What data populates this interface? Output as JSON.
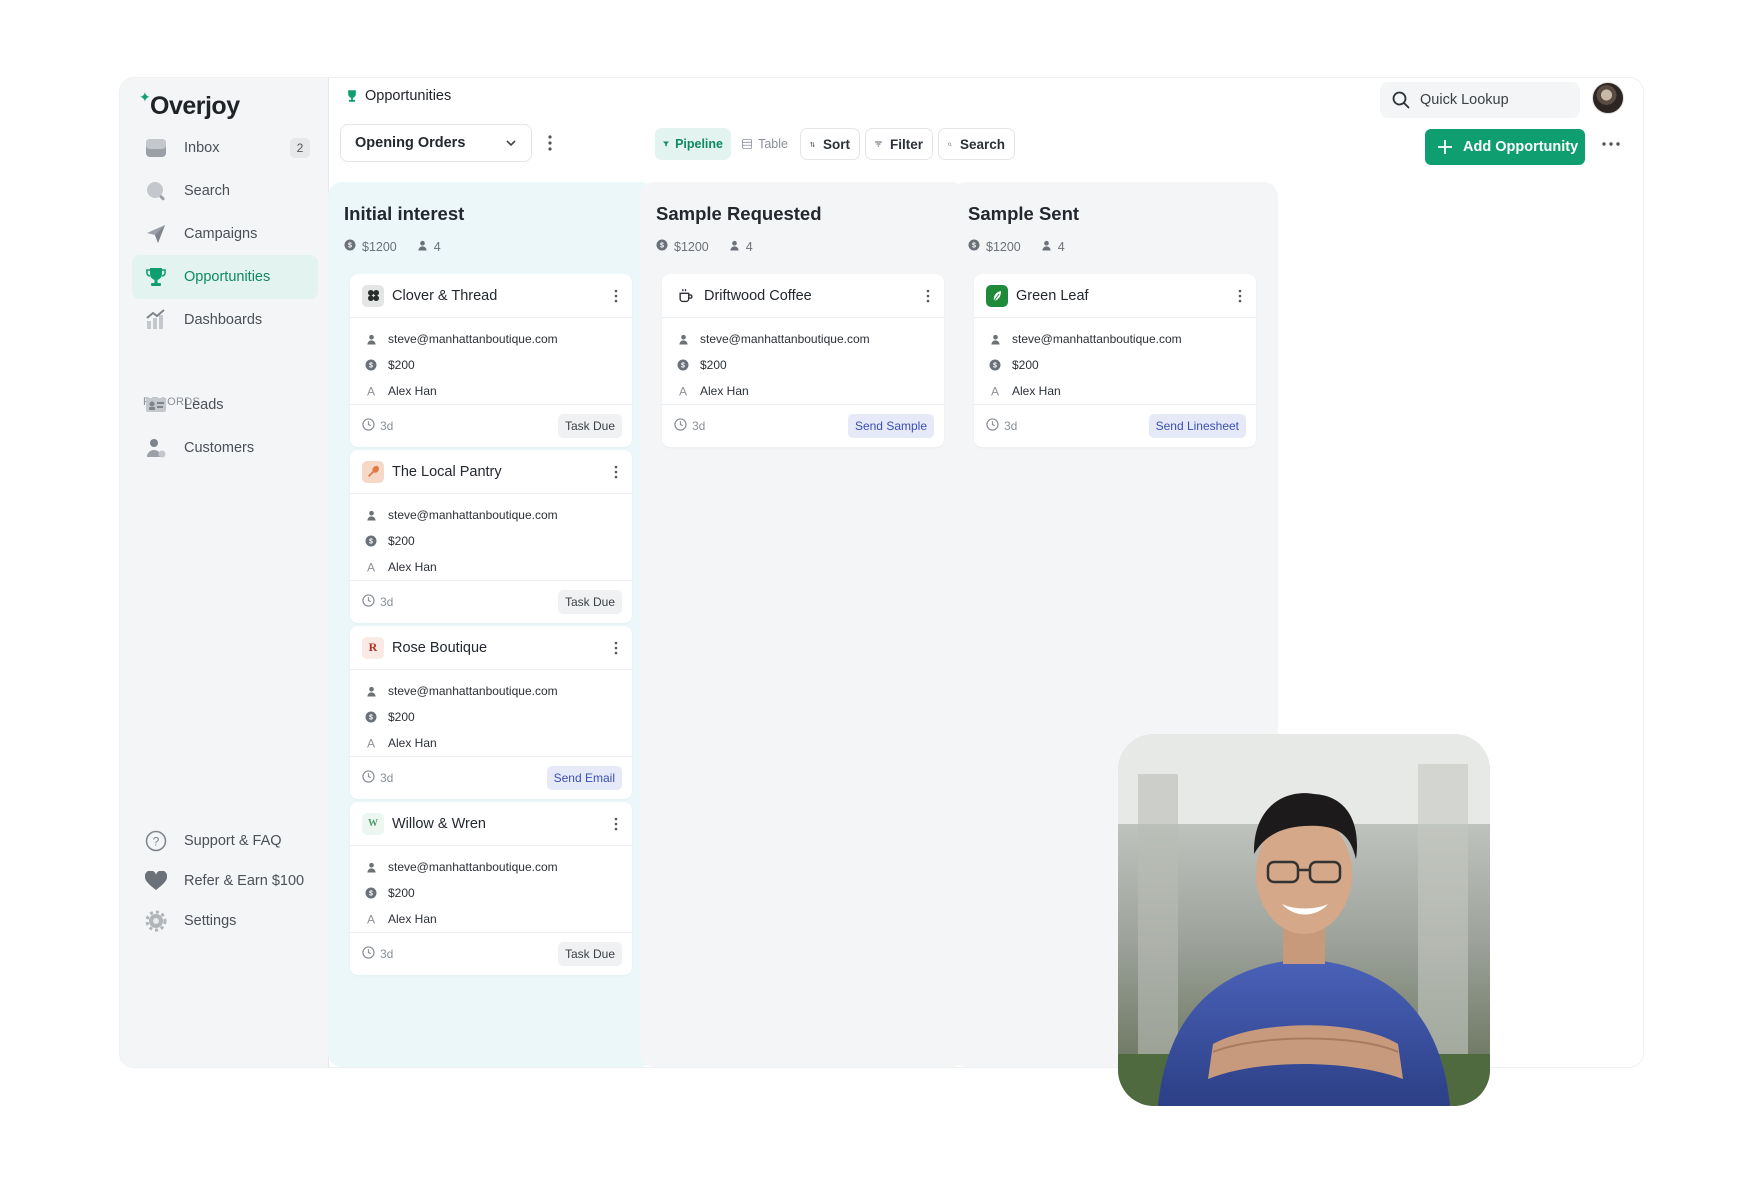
{
  "brand": {
    "name": "Overjoy",
    "accent": "#0f9e6f"
  },
  "sidebar": {
    "items": [
      {
        "label": "Inbox",
        "icon": "inbox-icon",
        "count": "2"
      },
      {
        "label": "Search",
        "icon": "search-icon"
      },
      {
        "label": "Campaigns",
        "icon": "paper-plane-icon"
      },
      {
        "label": "Opportunities",
        "icon": "trophy-icon",
        "active": true
      },
      {
        "label": "Dashboards",
        "icon": "chart-icon"
      }
    ],
    "section_label": "RECORDS",
    "records": [
      {
        "label": "Leads",
        "icon": "id-card-icon"
      },
      {
        "label": "Customers",
        "icon": "user-icon"
      }
    ],
    "bottom": [
      {
        "label": "Support & FAQ",
        "icon": "help-icon"
      },
      {
        "label": "Refer & Earn $100",
        "icon": "heart-icon"
      },
      {
        "label": "Settings",
        "icon": "gear-icon"
      }
    ]
  },
  "header": {
    "title": "Opportunities",
    "quick_lookup": "Quick Lookup",
    "view_select": "Opening Orders",
    "views": {
      "pipeline": "Pipeline",
      "table": "Table"
    },
    "tools": {
      "sort": "Sort",
      "filter": "Filter",
      "search": "Search"
    },
    "add_button": "Add Opportunity"
  },
  "columns": [
    {
      "title": "Initial interest",
      "amount": "$1200",
      "count": "4",
      "cards": [
        {
          "name": "Clover & Thread",
          "logo": "clover-icon",
          "email": "steve@manhattanboutique.com",
          "value": "$200",
          "owner": "Alex Han",
          "age": "3d",
          "action": "Task Due"
        },
        {
          "name": "The Local Pantry",
          "logo": "spoon-icon",
          "email": "steve@manhattanboutique.com",
          "value": "$200",
          "owner": "Alex Han",
          "age": "3d",
          "action": "Task Due"
        },
        {
          "name": "Rose Boutique",
          "logo": "R",
          "email": "steve@manhattanboutique.com",
          "value": "$200",
          "owner": "Alex Han",
          "age": "3d",
          "action": "Send Email"
        },
        {
          "name": "Willow & Wren",
          "logo": "W",
          "email": "steve@manhattanboutique.com",
          "value": "$200",
          "owner": "Alex Han",
          "age": "3d",
          "action": "Task Due"
        }
      ]
    },
    {
      "title": "Sample Requested",
      "amount": "$1200",
      "count": "4",
      "cards": [
        {
          "name": "Driftwood Coffee",
          "logo": "coffee-icon",
          "email": "steve@manhattanboutique.com",
          "value": "$200",
          "owner": "Alex Han",
          "age": "3d",
          "action": "Send Sample"
        }
      ]
    },
    {
      "title": "Sample Sent",
      "amount": "$1200",
      "count": "4",
      "cards": [
        {
          "name": "Green Leaf",
          "logo": "leaf-icon",
          "email": "steve@manhattanboutique.com",
          "value": "$200",
          "owner": "Alex Han",
          "age": "3d",
          "action": "Send Linesheet"
        }
      ]
    }
  ]
}
